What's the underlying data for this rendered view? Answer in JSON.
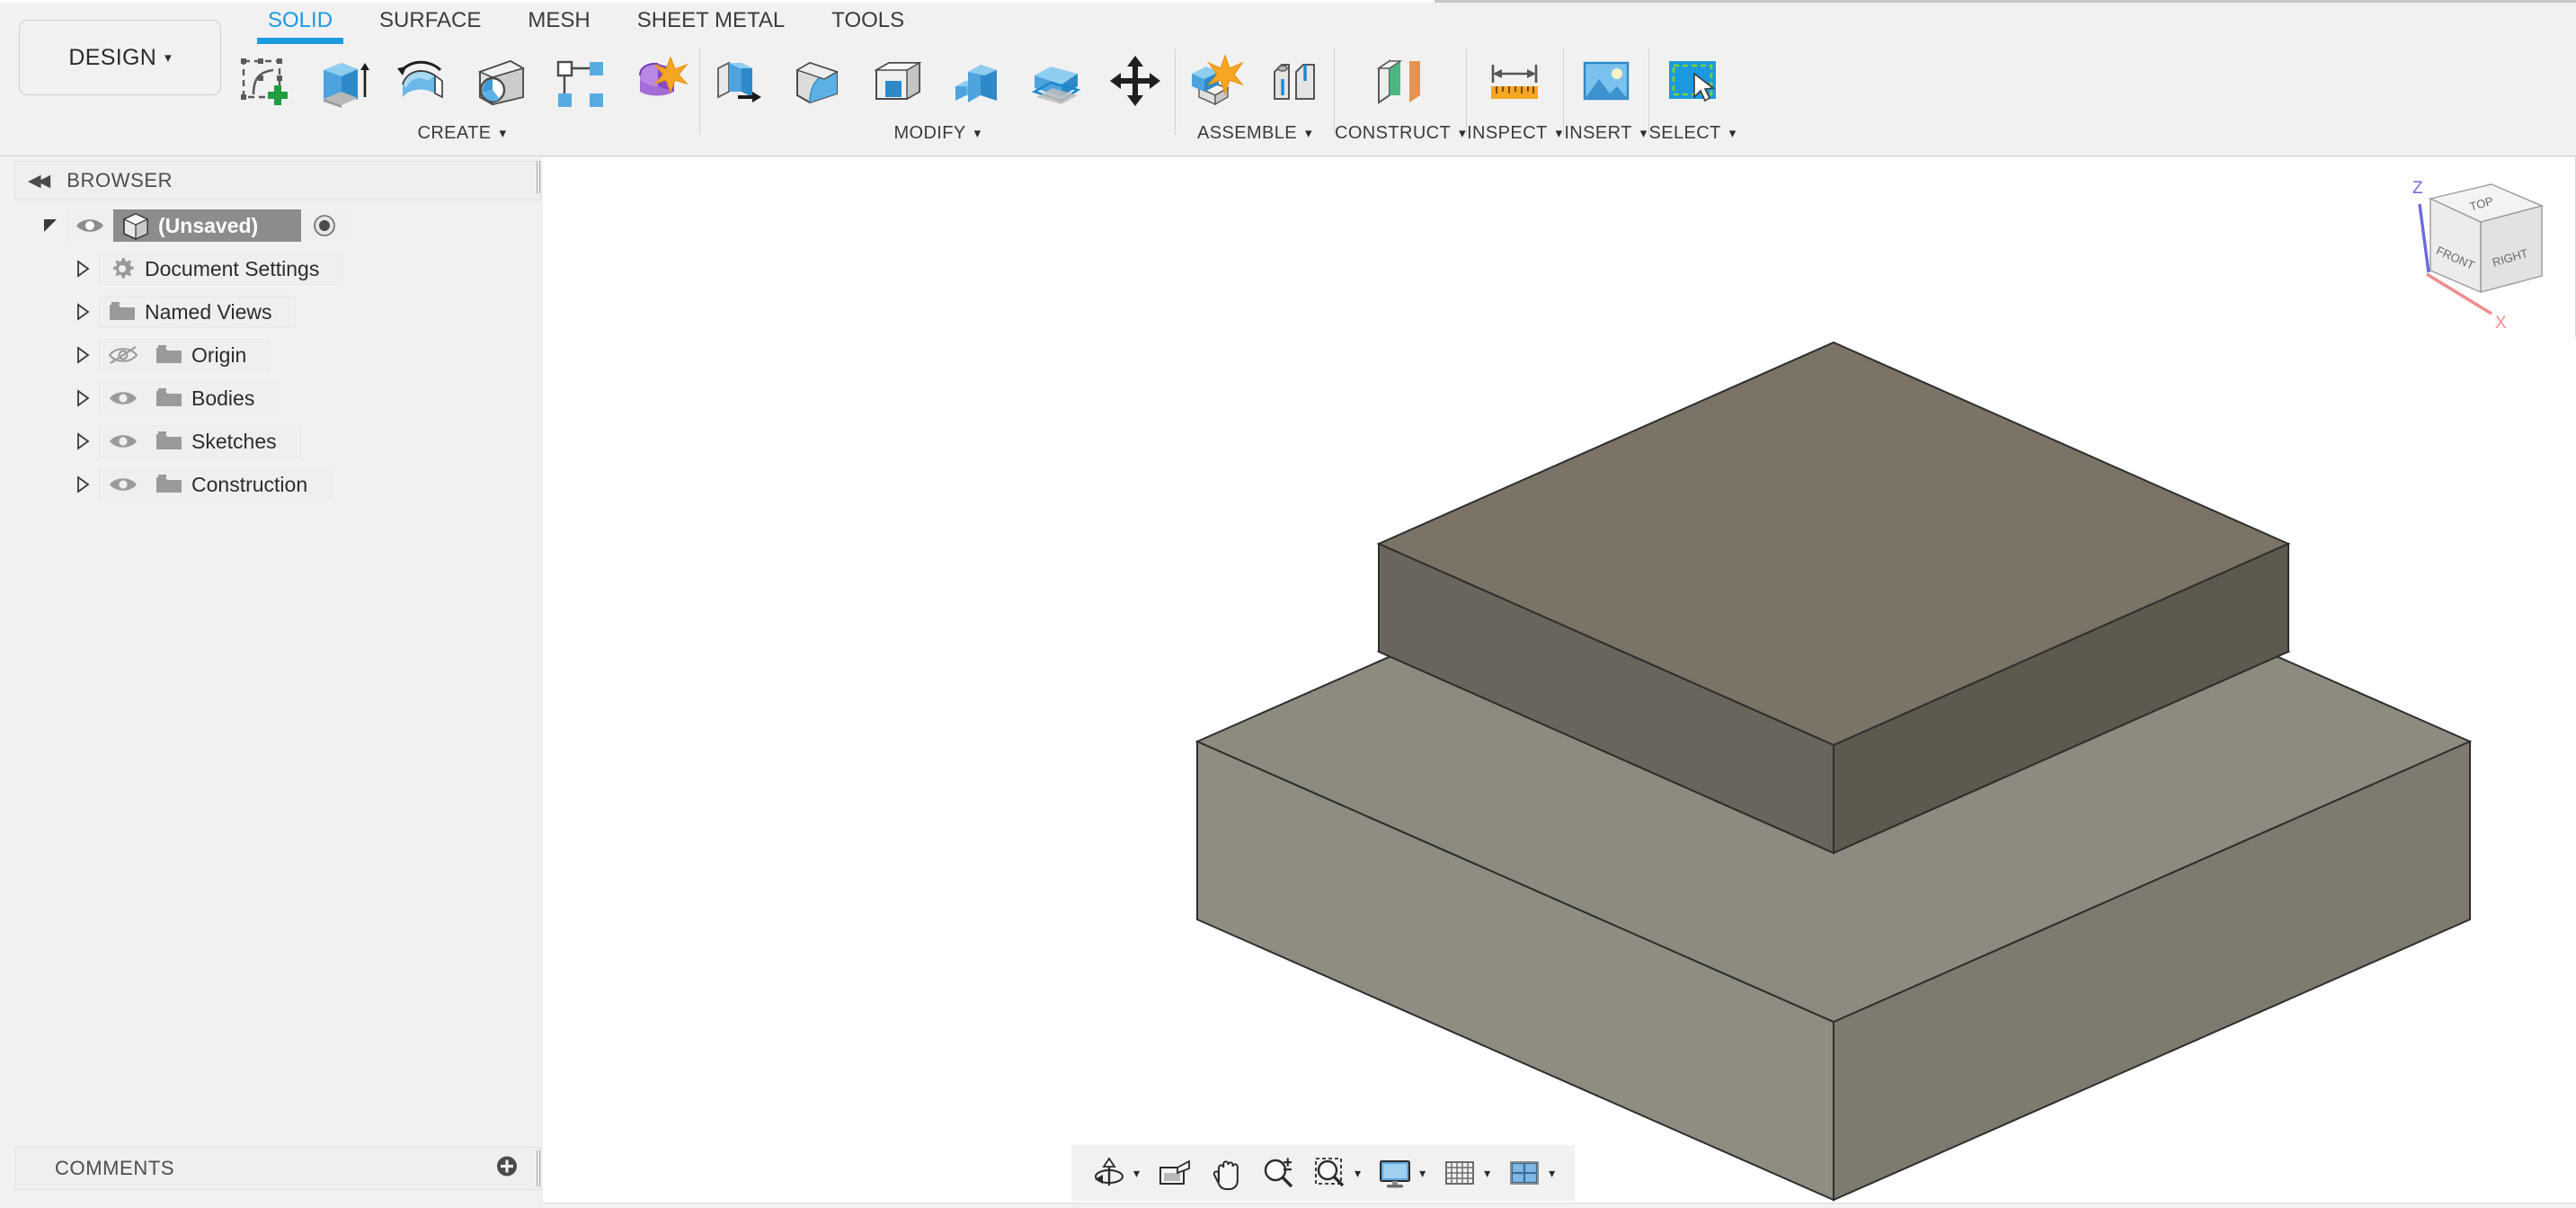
{
  "app": {
    "workspace_button": "DESIGN",
    "caret": "▾"
  },
  "tabs": [
    {
      "label": "SOLID",
      "active": true
    },
    {
      "label": "SURFACE",
      "active": false
    },
    {
      "label": "MESH",
      "active": false
    },
    {
      "label": "SHEET METAL",
      "active": false
    },
    {
      "label": "TOOLS",
      "active": false
    }
  ],
  "toolbar": {
    "groups": [
      {
        "label": "CREATE",
        "tools": [
          {
            "name": "create-sketch-icon",
            "title": "Create Sketch"
          },
          {
            "name": "extrude-icon",
            "title": "Extrude"
          },
          {
            "name": "revolve-icon",
            "title": "Revolve"
          },
          {
            "name": "hole-icon",
            "title": "Hole"
          },
          {
            "name": "rectangular-pattern-icon",
            "title": "Rectangular Pattern"
          },
          {
            "name": "create-form-icon",
            "title": "Create Form"
          }
        ]
      },
      {
        "label": "MODIFY",
        "tools": [
          {
            "name": "press-pull-icon",
            "title": "Press Pull"
          },
          {
            "name": "fillet-icon",
            "title": "Fillet"
          },
          {
            "name": "shell-icon",
            "title": "Shell"
          },
          {
            "name": "combine-icon",
            "title": "Combine"
          },
          {
            "name": "offset-face-icon",
            "title": "Offset Face"
          },
          {
            "name": "move-copy-icon",
            "title": "Move/Copy"
          }
        ]
      },
      {
        "label": "ASSEMBLE",
        "tools": [
          {
            "name": "new-component-icon",
            "title": "New Component"
          },
          {
            "name": "joint-icon",
            "title": "Joint"
          }
        ]
      },
      {
        "label": "CONSTRUCT",
        "tools": [
          {
            "name": "offset-plane-icon",
            "title": "Offset Plane"
          }
        ]
      },
      {
        "label": "INSPECT",
        "tools": [
          {
            "name": "measure-icon",
            "title": "Measure"
          }
        ]
      },
      {
        "label": "INSERT",
        "tools": [
          {
            "name": "insert-image-icon",
            "title": "Insert Image"
          }
        ]
      },
      {
        "label": "SELECT",
        "tools": [
          {
            "name": "select-icon",
            "title": "Select"
          }
        ]
      }
    ]
  },
  "browser": {
    "title": "BROWSER",
    "collapse_arrows": "◀◀",
    "root": {
      "label": "(Unsaved)",
      "visible": true,
      "selected": true
    },
    "items": [
      {
        "label": "Document Settings",
        "icon": "gear-icon",
        "has_eye": false,
        "eye_state": "none"
      },
      {
        "label": "Named Views",
        "icon": "folder-icon",
        "has_eye": false,
        "eye_state": "none"
      },
      {
        "label": "Origin",
        "icon": "folder-icon",
        "has_eye": true,
        "eye_state": "hidden"
      },
      {
        "label": "Bodies",
        "icon": "folder-icon",
        "has_eye": true,
        "eye_state": "visible"
      },
      {
        "label": "Sketches",
        "icon": "folder-icon",
        "has_eye": true,
        "eye_state": "visible"
      },
      {
        "label": "Construction",
        "icon": "folder-icon",
        "has_eye": true,
        "eye_state": "visible"
      }
    ]
  },
  "comments": {
    "title": "COMMENTS",
    "add_icon": "plus-circle-icon"
  },
  "viewcube": {
    "faces": {
      "top": "TOP",
      "front": "FRONT",
      "right": "RIGHT"
    },
    "axes": {
      "z": "Z",
      "x": "X"
    },
    "axis_colors": {
      "z": "#6a6ae0",
      "x": "#f08c8c"
    }
  },
  "navbar": {
    "items": [
      {
        "name": "orbit-icon",
        "label": "Orbit",
        "caret": "▾"
      },
      {
        "name": "look-at-icon",
        "label": "Look At",
        "caret": ""
      },
      {
        "name": "pan-icon",
        "label": "Pan",
        "caret": ""
      },
      {
        "name": "zoom-icon",
        "label": "Zoom",
        "caret": ""
      },
      {
        "name": "zoom-window-icon",
        "label": "Zoom Window",
        "caret": "▾"
      },
      {
        "name": "display-settings-icon",
        "label": "Display Settings",
        "caret": "▾"
      },
      {
        "name": "grid-snaps-icon",
        "label": "Grid and Snaps",
        "caret": "▾"
      },
      {
        "name": "viewports-icon",
        "label": "Viewports",
        "caret": "▾"
      }
    ]
  },
  "model": {
    "description": "Two-tier stepped square frustum solid body",
    "colors": {
      "top_face": "#7a7366",
      "upper_side_left": "#6a655c",
      "upper_side_right": "#5d594f",
      "base_top": "#8a867c",
      "base_side_left": "#8d8a80",
      "base_side_right": "#7c786e",
      "edge": "#2e2e2e"
    }
  },
  "theme": {
    "accent": "#1b9ae0",
    "ribbon_bg": "#f1f1f1",
    "canvas_bg": "#ffffff",
    "panel_bg": "#efefef",
    "text": "#2c2c2c"
  }
}
